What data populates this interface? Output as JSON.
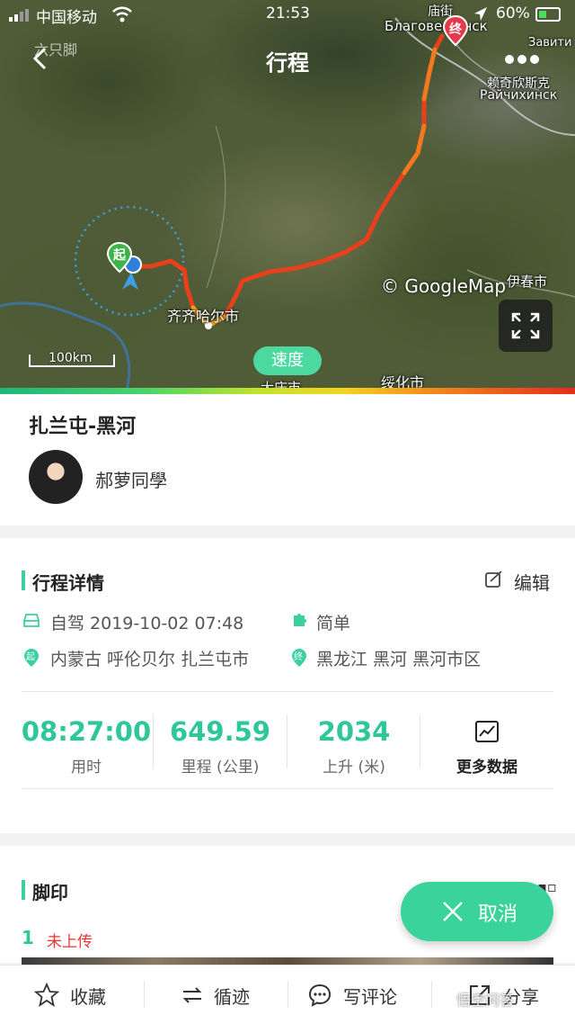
{
  "status_bar": {
    "carrier": "中国移动",
    "time": "21:53",
    "battery": "60%"
  },
  "header": {
    "title": "行程",
    "watermark": "六只脚"
  },
  "map": {
    "labels": {
      "blago": "Благовещенск",
      "heihe": "庙街",
      "zavitin": "Завити",
      "raichikhinsk_cn": "赖奇欣斯克",
      "raichikhinsk_ru": "Райчихинск",
      "yichun": "伊春市",
      "qiqihar": "齐齐哈尔市",
      "suihua": "绥化市",
      "daqing": "大庆市"
    },
    "start_marker": "起",
    "end_marker": "终",
    "attribution": "© GoogleMap",
    "scale": "100km",
    "speed_button": "速度"
  },
  "trip": {
    "route": "扎兰屯-黑河",
    "user_name": "郝萝同學"
  },
  "details": {
    "section_title": "行程详情",
    "edit_label": "编辑",
    "mode_datetime": "自驾 2019-10-02 07:48",
    "difficulty": "简单",
    "start_place": "内蒙古 呼伦贝尔 扎兰屯市",
    "end_place": "黑龙江 黑河 黑河市区",
    "start_pin": "起",
    "end_pin": "终",
    "stats": [
      {
        "value": "08:27:00",
        "label": "用时"
      },
      {
        "value": "649.59",
        "label": "里程 (公里)"
      },
      {
        "value": "2034",
        "label": "上升 (米)"
      }
    ],
    "more_data": "更多数据"
  },
  "footprint": {
    "section_title": "脚印",
    "index": "1",
    "upload_status": "未上传",
    "cancel_label": "取消"
  },
  "toolbar": {
    "favorite": "收藏",
    "follow_track": "循迹",
    "comment": "写评论",
    "share": "分享"
  },
  "watermark_bottom": "悟空问答",
  "colors": {
    "accent": "#3ccfa4",
    "route": "#e53a1c",
    "upload_status": "#e33333"
  }
}
